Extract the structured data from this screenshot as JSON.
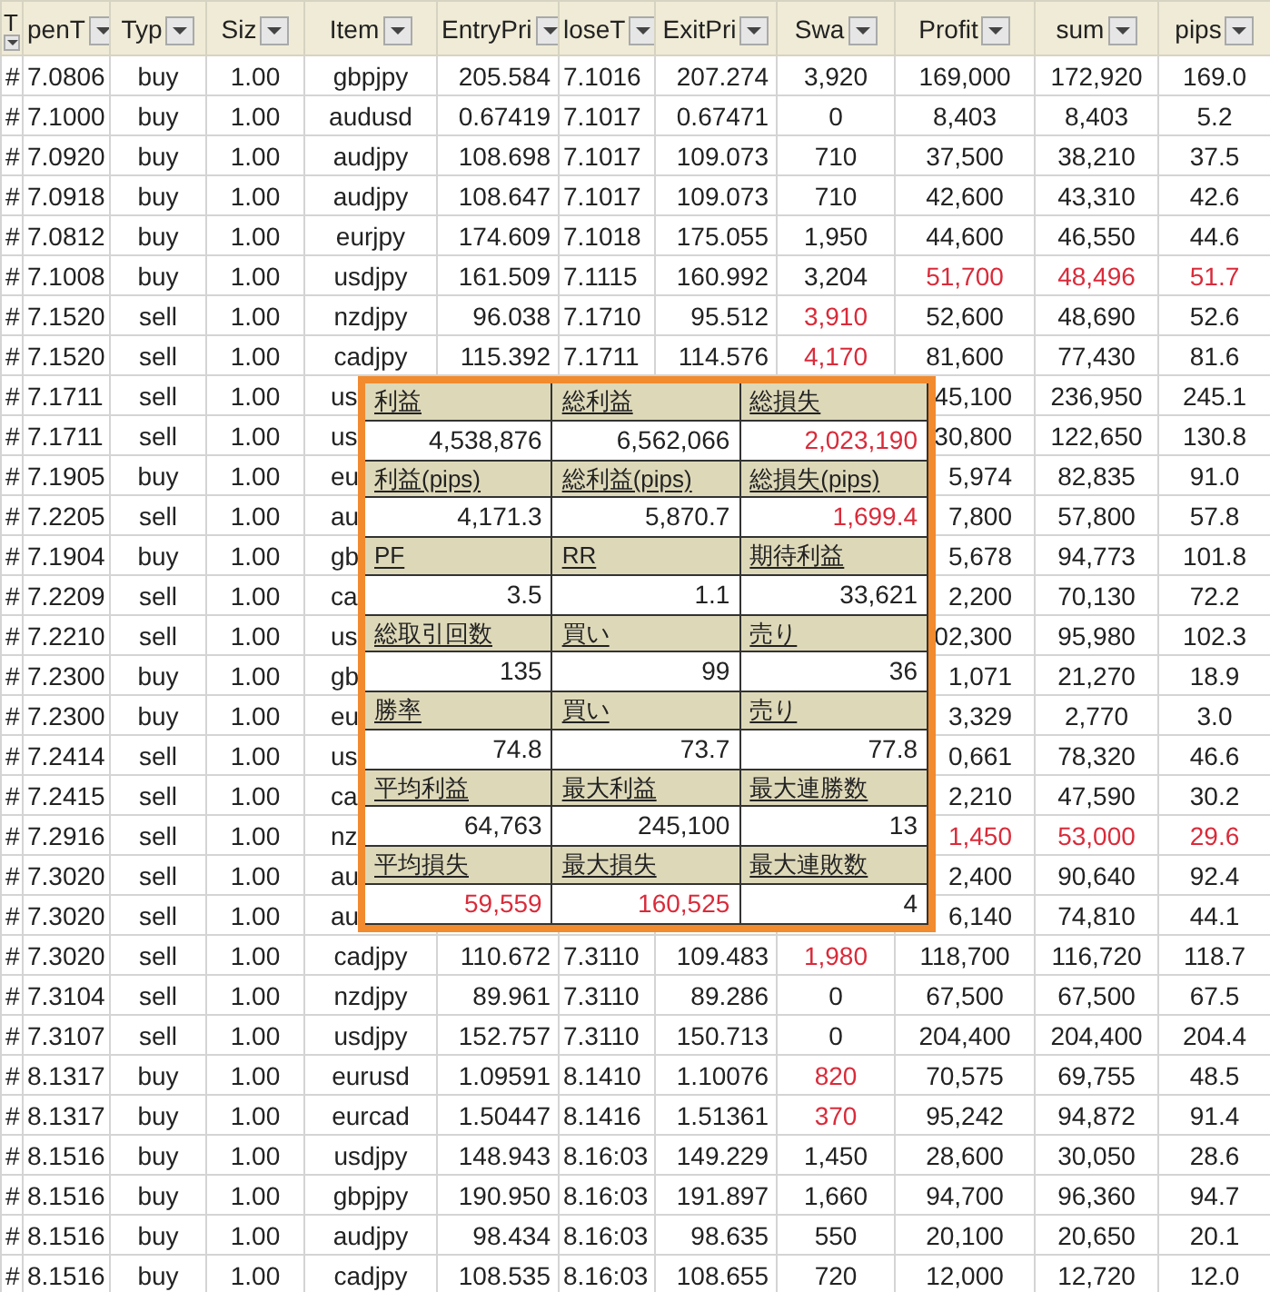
{
  "columns": [
    "T",
    "penT",
    "Typ",
    "Siz",
    "Item",
    "EntryPri",
    "loseT",
    "ExitPri",
    "Swa",
    "Profit",
    "sum",
    "pips"
  ],
  "rows": [
    {
      "mark": "#",
      "open": "7.0806",
      "type": "buy",
      "size": "1.00",
      "item": "gbpjpy",
      "entry": "205.584",
      "close": "7.1016",
      "exit": "207.274",
      "swap": "3,920",
      "profit": "169,000",
      "sum": "172,920",
      "pips": "169.0",
      "swap_negative": false,
      "profit_negative": false
    },
    {
      "mark": "#",
      "open": "7.1000",
      "type": "buy",
      "size": "1.00",
      "item": "audusd",
      "entry": "0.67419",
      "close": "7.1017",
      "exit": "0.67471",
      "swap": "0",
      "profit": "8,403",
      "sum": "8,403",
      "pips": "5.2",
      "swap_negative": false,
      "profit_negative": false
    },
    {
      "mark": "#",
      "open": "7.0920",
      "type": "buy",
      "size": "1.00",
      "item": "audjpy",
      "entry": "108.698",
      "close": "7.1017",
      "exit": "109.073",
      "swap": "710",
      "profit": "37,500",
      "sum": "38,210",
      "pips": "37.5",
      "swap_negative": false,
      "profit_negative": false
    },
    {
      "mark": "#",
      "open": "7.0918",
      "type": "buy",
      "size": "1.00",
      "item": "audjpy",
      "entry": "108.647",
      "close": "7.1017",
      "exit": "109.073",
      "swap": "710",
      "profit": "42,600",
      "sum": "43,310",
      "pips": "42.6",
      "swap_negative": false,
      "profit_negative": false
    },
    {
      "mark": "#",
      "open": "7.0812",
      "type": "buy",
      "size": "1.00",
      "item": "eurjpy",
      "entry": "174.609",
      "close": "7.1018",
      "exit": "175.055",
      "swap": "1,950",
      "profit": "44,600",
      "sum": "46,550",
      "pips": "44.6",
      "swap_negative": false,
      "profit_negative": false
    },
    {
      "mark": "#",
      "open": "7.1008",
      "type": "buy",
      "size": "1.00",
      "item": "usdjpy",
      "entry": "161.509",
      "close": "7.1115",
      "exit": "160.992",
      "swap": "3,204",
      "profit": "51,700",
      "sum": "48,496",
      "pips": "51.7",
      "swap_negative": false,
      "profit_negative": true
    },
    {
      "mark": "#",
      "open": "7.1520",
      "type": "sell",
      "size": "1.00",
      "item": "nzdjpy",
      "entry": "96.038",
      "close": "7.1710",
      "exit": "95.512",
      "swap": "3,910",
      "profit": "52,600",
      "sum": "48,690",
      "pips": "52.6",
      "swap_negative": true,
      "profit_negative": false
    },
    {
      "mark": "#",
      "open": "7.1520",
      "type": "sell",
      "size": "1.00",
      "item": "cadjpy",
      "entry": "115.392",
      "close": "7.1711",
      "exit": "114.576",
      "swap": "4,170",
      "profit": "81,600",
      "sum": "77,430",
      "pips": "81.6",
      "swap_negative": true,
      "profit_negative": false
    },
    {
      "mark": "#",
      "open": "7.1711",
      "type": "sell",
      "size": "1.00",
      "item": "us",
      "profit": "45,100",
      "sum": "236,950",
      "pips": "245.1",
      "profit_negative": false
    },
    {
      "mark": "#",
      "open": "7.1711",
      "type": "sell",
      "size": "1.00",
      "item": "us",
      "profit": "30,800",
      "sum": "122,650",
      "pips": "130.8",
      "profit_negative": false
    },
    {
      "mark": "#",
      "open": "7.1905",
      "type": "buy",
      "size": "1.00",
      "item": "eu",
      "profit": "5,974",
      "sum": "82,835",
      "pips": "91.0",
      "profit_negative": false
    },
    {
      "mark": "#",
      "open": "7.2205",
      "type": "sell",
      "size": "1.00",
      "item": "au",
      "profit": "7,800",
      "sum": "57,800",
      "pips": "57.8",
      "profit_negative": false
    },
    {
      "mark": "#",
      "open": "7.1904",
      "type": "buy",
      "size": "1.00",
      "item": "gb",
      "profit": "5,678",
      "sum": "94,773",
      "pips": "101.8",
      "profit_negative": false
    },
    {
      "mark": "#",
      "open": "7.2209",
      "type": "sell",
      "size": "1.00",
      "item": "ca",
      "profit": "2,200",
      "sum": "70,130",
      "pips": "72.2",
      "profit_negative": false
    },
    {
      "mark": "#",
      "open": "7.2210",
      "type": "sell",
      "size": "1.00",
      "item": "us",
      "profit": "02,300",
      "sum": "95,980",
      "pips": "102.3",
      "profit_negative": false
    },
    {
      "mark": "#",
      "open": "7.2300",
      "type": "buy",
      "size": "1.00",
      "item": "gb",
      "profit": "1,071",
      "sum": "21,270",
      "pips": "18.9",
      "profit_negative": false
    },
    {
      "mark": "#",
      "open": "7.2300",
      "type": "buy",
      "size": "1.00",
      "item": "eu",
      "profit": "3,329",
      "sum": "2,770",
      "pips": "3.0",
      "profit_negative": false
    },
    {
      "mark": "#",
      "open": "7.2414",
      "type": "sell",
      "size": "1.00",
      "item": "us",
      "profit": "0,661",
      "sum": "78,320",
      "pips": "46.6",
      "profit_negative": false
    },
    {
      "mark": "#",
      "open": "7.2415",
      "type": "sell",
      "size": "1.00",
      "item": "ca",
      "profit": "2,210",
      "sum": "47,590",
      "pips": "30.2",
      "profit_negative": false
    },
    {
      "mark": "#",
      "open": "7.2916",
      "type": "sell",
      "size": "1.00",
      "item": "nz",
      "profit": "1,450",
      "sum": "53,000",
      "pips": "29.6",
      "profit_negative": true
    },
    {
      "mark": "#",
      "open": "7.3020",
      "type": "sell",
      "size": "1.00",
      "item": "au",
      "profit": "2,400",
      "sum": "90,640",
      "pips": "92.4",
      "profit_negative": false
    },
    {
      "mark": "#",
      "open": "7.3020",
      "type": "sell",
      "size": "1.00",
      "item": "au",
      "profit": "6,140",
      "sum": "74,810",
      "pips": "44.1",
      "profit_negative": false
    },
    {
      "mark": "#",
      "open": "7.3020",
      "type": "sell",
      "size": "1.00",
      "item": "cadjpy",
      "entry": "110.672",
      "close": "7.3110",
      "exit": "109.483",
      "swap": "1,980",
      "profit": "118,700",
      "sum": "116,720",
      "pips": "118.7",
      "swap_negative": true,
      "profit_negative": false
    },
    {
      "mark": "#",
      "open": "7.3104",
      "type": "sell",
      "size": "1.00",
      "item": "nzdjpy",
      "entry": "89.961",
      "close": "7.3110",
      "exit": "89.286",
      "swap": "0",
      "profit": "67,500",
      "sum": "67,500",
      "pips": "67.5",
      "swap_negative": false,
      "profit_negative": false
    },
    {
      "mark": "#",
      "open": "7.3107",
      "type": "sell",
      "size": "1.00",
      "item": "usdjpy",
      "entry": "152.757",
      "close": "7.3110",
      "exit": "150.713",
      "swap": "0",
      "profit": "204,400",
      "sum": "204,400",
      "pips": "204.4",
      "swap_negative": false,
      "profit_negative": false
    },
    {
      "mark": "#",
      "open": "8.1317",
      "type": "buy",
      "size": "1.00",
      "item": "eurusd",
      "entry": "1.09591",
      "close": "8.1410",
      "exit": "1.10076",
      "swap": "820",
      "profit": "70,575",
      "sum": "69,755",
      "pips": "48.5",
      "swap_negative": true,
      "profit_negative": false
    },
    {
      "mark": "#",
      "open": "8.1317",
      "type": "buy",
      "size": "1.00",
      "item": "eurcad",
      "entry": "1.50447",
      "close": "8.1416",
      "exit": "1.51361",
      "swap": "370",
      "profit": "95,242",
      "sum": "94,872",
      "pips": "91.4",
      "swap_negative": true,
      "profit_negative": false
    },
    {
      "mark": "#",
      "open": "8.1516",
      "type": "buy",
      "size": "1.00",
      "item": "usdjpy",
      "entry": "148.943",
      "close": "8.16:03",
      "exit": "149.229",
      "swap": "1,450",
      "profit": "28,600",
      "sum": "30,050",
      "pips": "28.6",
      "swap_negative": false,
      "profit_negative": false
    },
    {
      "mark": "#",
      "open": "8.1516",
      "type": "buy",
      "size": "1.00",
      "item": "gbpjpy",
      "entry": "190.950",
      "close": "8.16:03",
      "exit": "191.897",
      "swap": "1,660",
      "profit": "94,700",
      "sum": "96,360",
      "pips": "94.7",
      "swap_negative": false,
      "profit_negative": false
    },
    {
      "mark": "#",
      "open": "8.1516",
      "type": "buy",
      "size": "1.00",
      "item": "audjpy",
      "entry": "98.434",
      "close": "8.16:03",
      "exit": "98.635",
      "swap": "550",
      "profit": "20,100",
      "sum": "20,650",
      "pips": "20.1",
      "swap_negative": false,
      "profit_negative": false
    },
    {
      "mark": "#",
      "open": "8.1516",
      "type": "buy",
      "size": "1.00",
      "item": "cadjpy",
      "entry": "108.535",
      "close": "8.16:03",
      "exit": "108.655",
      "swap": "720",
      "profit": "12,000",
      "sum": "12,720",
      "pips": "12.0",
      "swap_negative": false,
      "profit_negative": false
    }
  ],
  "summary": [
    {
      "labels": [
        "利益",
        "総利益",
        "総損失"
      ],
      "values": [
        {
          "text": "4,538,876",
          "negative": false
        },
        {
          "text": "6,562,066",
          "negative": false
        },
        {
          "text": "2,023,190",
          "negative": true
        }
      ]
    },
    {
      "labels": [
        "利益(pips)",
        "総利益(pips)",
        "総損失(pips)"
      ],
      "values": [
        {
          "text": "4,171.3",
          "negative": false
        },
        {
          "text": "5,870.7",
          "negative": false
        },
        {
          "text": "1,699.4",
          "negative": true
        }
      ]
    },
    {
      "labels": [
        "PF",
        "RR",
        "期待利益"
      ],
      "values": [
        {
          "text": "3.5",
          "negative": false
        },
        {
          "text": "1.1",
          "negative": false
        },
        {
          "text": "33,621",
          "negative": false
        }
      ]
    },
    {
      "labels": [
        "総取引回数",
        "買い",
        "売り"
      ],
      "values": [
        {
          "text": "135",
          "negative": false
        },
        {
          "text": "99",
          "negative": false
        },
        {
          "text": "36",
          "negative": false
        }
      ]
    },
    {
      "labels": [
        "勝率",
        "買い",
        "売り"
      ],
      "values": [
        {
          "text": "74.8",
          "negative": false
        },
        {
          "text": "73.7",
          "negative": false
        },
        {
          "text": "77.8",
          "negative": false
        }
      ]
    },
    {
      "labels": [
        "平均利益",
        "最大利益",
        "最大連勝数"
      ],
      "values": [
        {
          "text": "64,763",
          "negative": false
        },
        {
          "text": "245,100",
          "negative": false
        },
        {
          "text": "13",
          "negative": false
        }
      ]
    },
    {
      "labels": [
        "平均損失",
        "最大損失",
        "最大連敗数"
      ],
      "values": [
        {
          "text": "59,559",
          "negative": true
        },
        {
          "text": "160,525",
          "negative": true
        },
        {
          "text": "4",
          "negative": false
        }
      ]
    }
  ]
}
